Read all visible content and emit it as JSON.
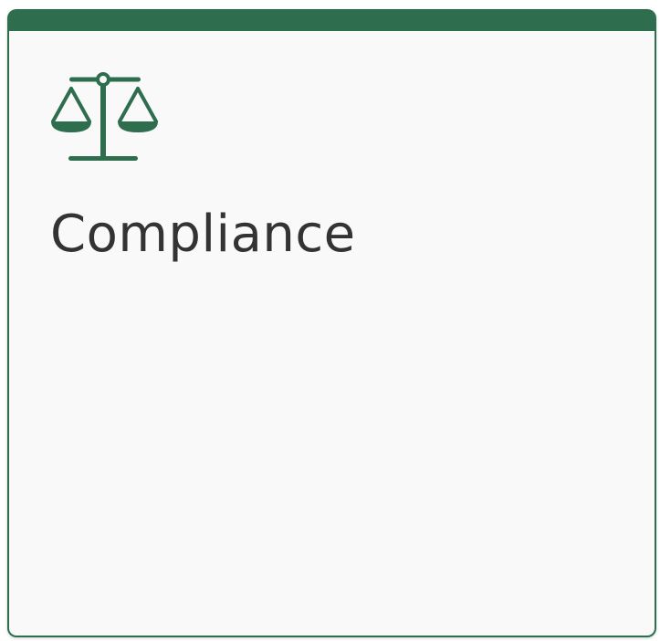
{
  "tile": {
    "label": "Compliance",
    "icon": "scales-icon",
    "accent_color": "#2e6e4f",
    "text_color": "#333333",
    "background_color": "#f9f9fa"
  }
}
